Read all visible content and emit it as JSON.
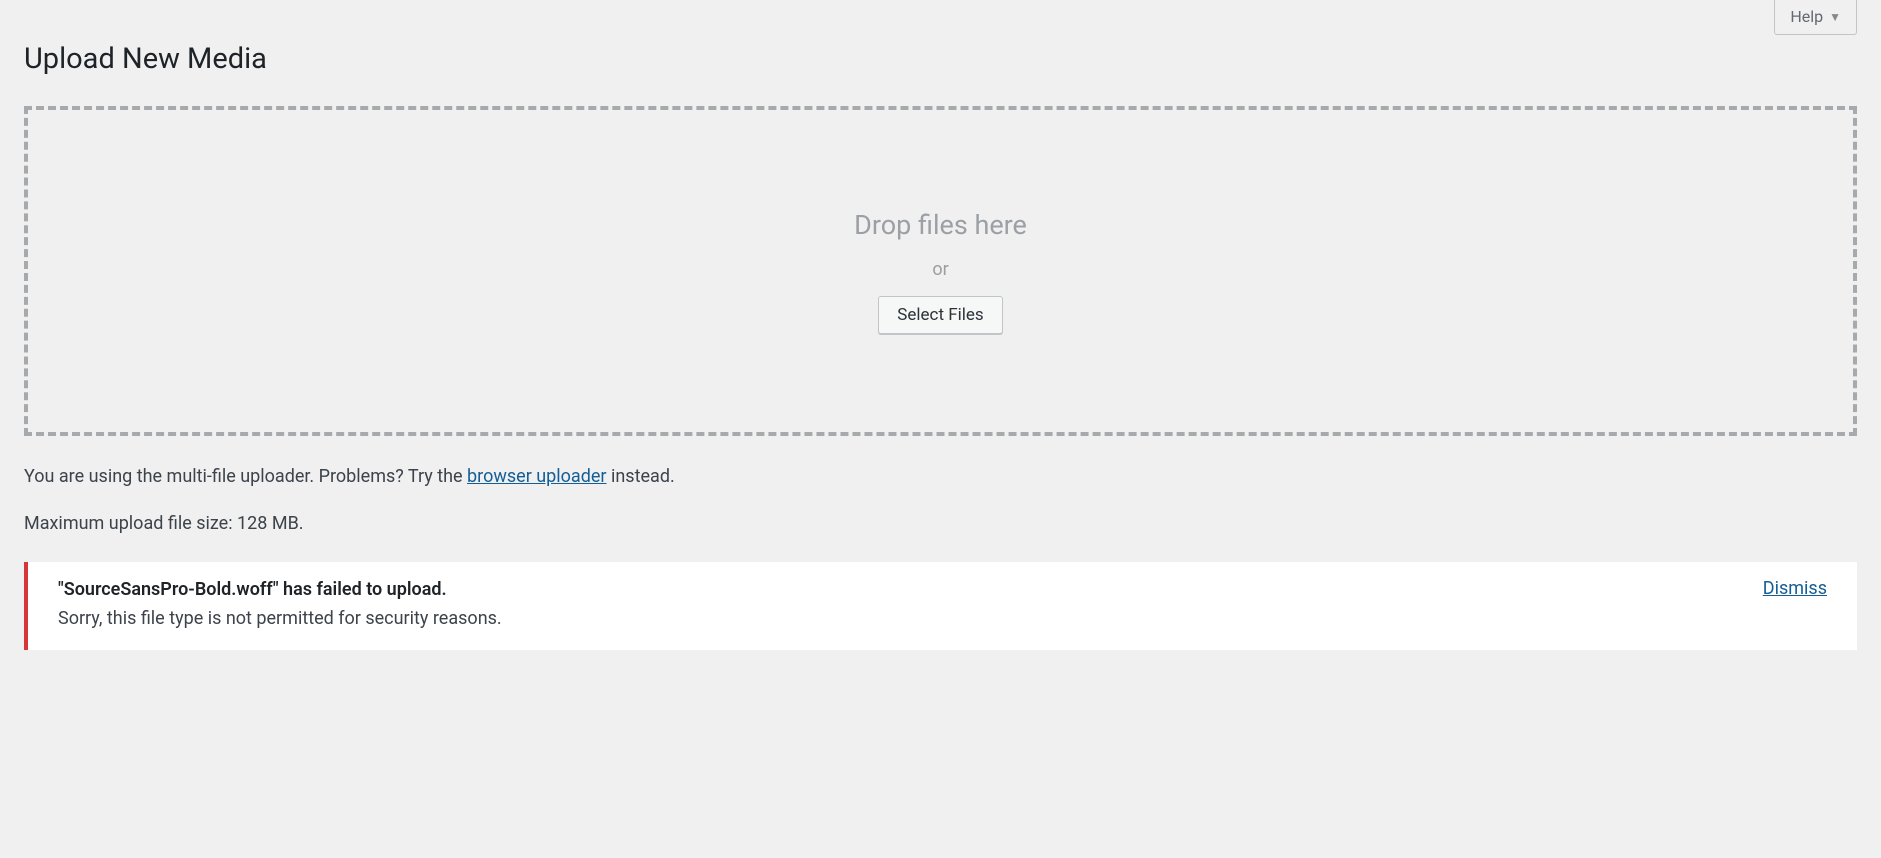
{
  "header": {
    "help_label": "Help"
  },
  "page_title": "Upload New Media",
  "dropzone": {
    "drop_text": "Drop files here",
    "or_text": "or",
    "select_button": "Select Files"
  },
  "info": {
    "prefix": "You are using the multi-file uploader. Problems? Try the ",
    "link_text": "browser uploader",
    "suffix": " instead."
  },
  "max_size": "Maximum upload file size: 128 MB.",
  "error": {
    "filename_quoted": "\"SourceSansPro-Bold.woff\"",
    "failed_text": " has failed to upload.",
    "detail": "Sorry, this file type is not permitted for security reasons.",
    "dismiss": "Dismiss"
  }
}
